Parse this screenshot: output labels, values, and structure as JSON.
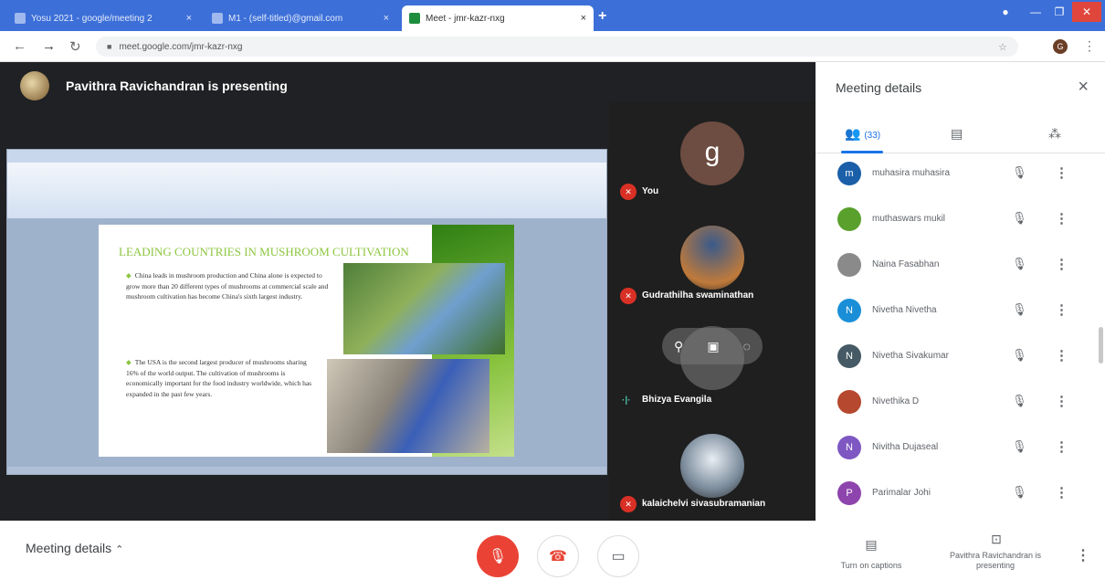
{
  "browser": {
    "tabs": [
      {
        "title": "Yosu 2021 - google/meeting 2",
        "active": false
      },
      {
        "title": "M1 - (self-titled)@gmail.com",
        "active": false
      },
      {
        "title": "Meet - jmr-kazr-nxg",
        "active": true
      }
    ],
    "new_tab": "+",
    "tab_close": "×",
    "url": "meet.google.com/jmr-kazr-nxg",
    "profile_initial": "G"
  },
  "stage": {
    "presenter_text": "Pavithra Ravichandran is presenting",
    "slide": {
      "title": "LEADING COUNTRIES IN MUSHROOM CULTIVATION",
      "bullet1": "China leads in mushroom production and China alone is expected to grow more than 20 different types of mushrooms at commercial scale and mushroom cultivation has become China's sixth largest industry.",
      "bullet2": "The USA is the second largest producer of mushrooms sharing 16% of the world output. The cultivation of mushrooms is economically important for the food industry worldwide, which has expanded in the past few years."
    }
  },
  "tiles": [
    {
      "name": "You",
      "initial": "g",
      "muted": true
    },
    {
      "name": "Gudrathilha swaminathan",
      "muted": true
    },
    {
      "name": "Bhizya Evangila",
      "muted": false
    },
    {
      "name": "kalaichelvi sivasubramanian",
      "muted": true
    }
  ],
  "sidebar": {
    "title": "Meeting details",
    "people_count": "(33)",
    "participants": [
      {
        "name": "muhasira muhasira",
        "initial": "m",
        "color": "#1a5fa8"
      },
      {
        "name": "muthaswars mukil",
        "initial": "",
        "color": "#5aa02c"
      },
      {
        "name": "Naina Fasabhan",
        "initial": "",
        "color": "#8a8a8a"
      },
      {
        "name": "Nivetha Nivetha",
        "initial": "N",
        "color": "#1a8fd8"
      },
      {
        "name": "Nivetha Sivakumar",
        "initial": "N",
        "color": "#455a64"
      },
      {
        "name": "Nivethika D",
        "initial": "",
        "color": "#b5482e"
      },
      {
        "name": "Nivitha Dujaseal",
        "initial": "N",
        "color": "#7e57c2"
      },
      {
        "name": "Parimalar Johi",
        "initial": "P",
        "color": "#8e44ad"
      }
    ]
  },
  "bottom": {
    "meeting_details": "Meeting details",
    "captions_label": "Turn on captions",
    "presenting_label": "Pavithra Ravichandran is presenting"
  },
  "colors": {
    "accent": "#1a73e8",
    "danger": "#ea4335",
    "stage": "#202124"
  }
}
